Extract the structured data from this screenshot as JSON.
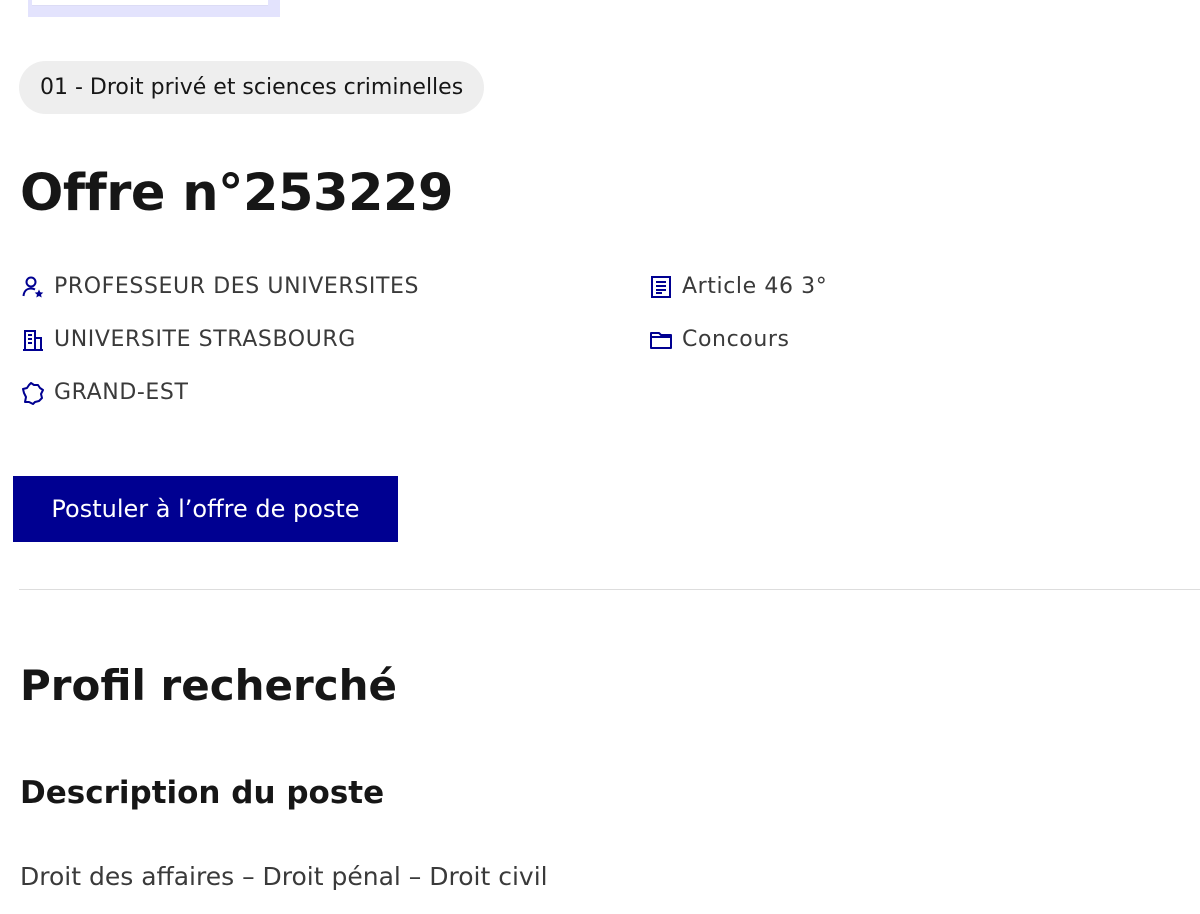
{
  "discipline_tag": "01 - Droit privé et sciences criminelles",
  "offer_title": "Offre n°253229",
  "meta": {
    "grade": {
      "icon": "user-star-icon",
      "label": "PROFESSEUR DES UNIVERSITES"
    },
    "institution": {
      "icon": "building-icon",
      "label": "UNIVERSITE STRASBOURG"
    },
    "region": {
      "icon": "france-map-icon",
      "label": "GRAND-EST"
    },
    "article": {
      "icon": "article-icon",
      "label": "Article 46 3°"
    },
    "recruitment": {
      "icon": "folder-icon",
      "label": "Concours"
    }
  },
  "apply_button_label": "Postuler à l’offre de poste",
  "profile_section": {
    "title": "Profil recherché",
    "subtitle": "Description du poste",
    "description": "Droit des affaires – Droit pénal – Droit civil"
  },
  "colors": {
    "accent": "#000091",
    "tag_background": "#eeeeee",
    "card_background": "#e3e3fd"
  }
}
